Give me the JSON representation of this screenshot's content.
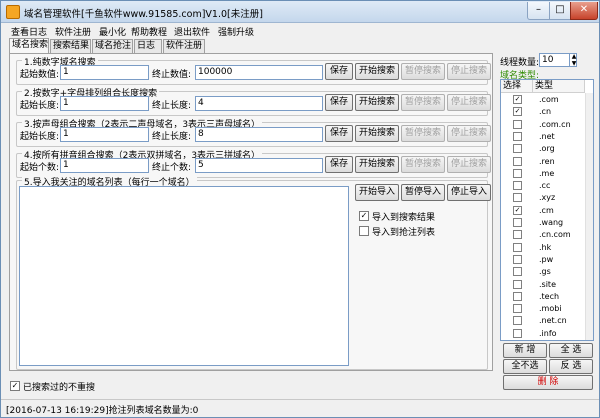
{
  "window": {
    "title": "域名管理软件[千鱼软件www.91585.com]V1.0[未注册]"
  },
  "menu": [
    "查看日志",
    "软件注册",
    "最小化",
    "帮助教程",
    "退出软件",
    "强制升级"
  ],
  "tabs": [
    "域名搜索",
    "搜索结果",
    "域名抢注",
    "日志",
    "软件注册"
  ],
  "sections": [
    {
      "title": "1.纯数字域名搜索",
      "start_label": "起始数值:",
      "start_value": "1",
      "end_label": "终止数值:",
      "end_value": "100000"
    },
    {
      "title": "2.按数字+字母排列组合长度搜索",
      "start_label": "起始长度:",
      "start_value": "1",
      "end_label": "终止长度:",
      "end_value": "4"
    },
    {
      "title": "3.按声母组合搜索（2表示二声母域名，3表示三声母域名）",
      "start_label": "起始长度:",
      "start_value": "1",
      "end_label": "终止长度:",
      "end_value": "8"
    },
    {
      "title": "4.按所有拼音组合搜索（2表示双拼域名，3表示三拼域名）",
      "start_label": "起始个数:",
      "start_value": "1",
      "end_label": "终止个数:",
      "end_value": "5"
    }
  ],
  "buttons": {
    "save": "保存",
    "start_search": "开始搜索",
    "pause_search": "暂停搜索",
    "stop_search": "停止搜索"
  },
  "import_section": {
    "title": "5.导入我关注的域名列表（每行一个域名）",
    "start_import": "开始导入",
    "pause_import": "暂停导入",
    "stop_import": "停止导入",
    "to_results": "导入到搜索结果",
    "to_results_checked": true,
    "to_snipe": "导入到抢注列表",
    "to_snipe_checked": false
  },
  "no_repeat": {
    "label": "已搜索过的不重搜",
    "checked": true
  },
  "thread": {
    "label": "线程数量:",
    "value": "10"
  },
  "domain_types": {
    "label": "域名类型:",
    "col_select": "选择",
    "col_type": "类型",
    "items": [
      {
        "name": ".com",
        "checked": true
      },
      {
        "name": ".cn",
        "checked": true
      },
      {
        "name": ".com.cn",
        "checked": false
      },
      {
        "name": ".net",
        "checked": false
      },
      {
        "name": ".org",
        "checked": false
      },
      {
        "name": ".ren",
        "checked": false
      },
      {
        "name": ".me",
        "checked": false
      },
      {
        "name": ".cc",
        "checked": false
      },
      {
        "name": ".xyz",
        "checked": false
      },
      {
        "name": ".cm",
        "checked": true
      },
      {
        "name": ".wang",
        "checked": false
      },
      {
        "name": ".cn.com",
        "checked": false
      },
      {
        "name": ".hk",
        "checked": false
      },
      {
        "name": ".pw",
        "checked": false
      },
      {
        "name": ".gs",
        "checked": false
      },
      {
        "name": ".site",
        "checked": false
      },
      {
        "name": ".tech",
        "checked": false
      },
      {
        "name": ".mobi",
        "checked": false
      },
      {
        "name": ".net.cn",
        "checked": false
      },
      {
        "name": ".info",
        "checked": false
      }
    ]
  },
  "list_buttons": {
    "add": "新 增",
    "select_all": "全 选",
    "select_none": "全不选",
    "invert": "反 选",
    "delete": "删 除"
  },
  "status": "[2016-07-13 16:19:29]抢注列表域名数量为:0"
}
